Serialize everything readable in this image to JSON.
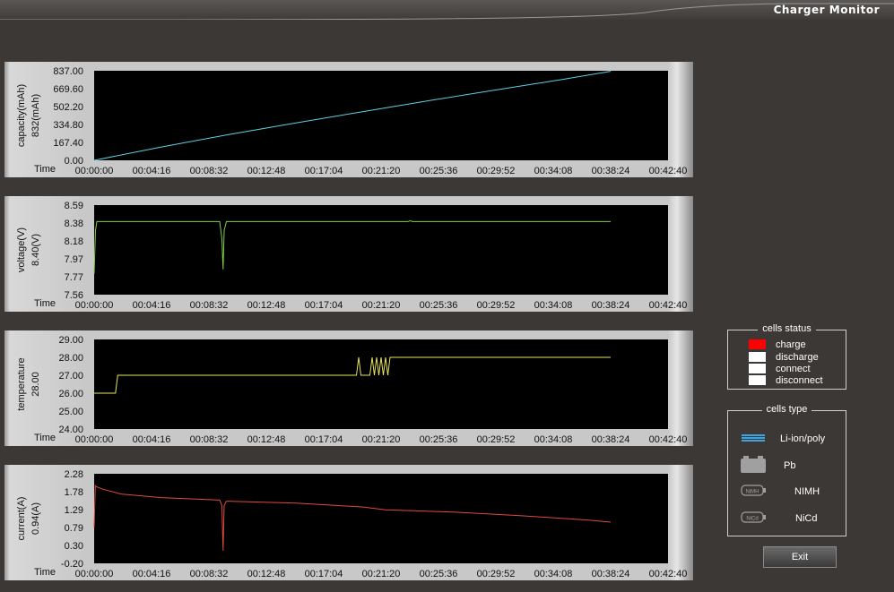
{
  "app_title": "Charger Monitor",
  "time_ticks": [
    "00:00:00",
    "00:04:16",
    "00:08:32",
    "00:12:48",
    "00:17:04",
    "00:21:20",
    "00:25:36",
    "00:29:52",
    "00:34:08",
    "00:38:24",
    "00:42:40"
  ],
  "time_label": "Time",
  "colors": {
    "capacity": "#5fd0e0",
    "voltage": "#7ecf4a",
    "temperature": "#e8e65a",
    "current": "#e04a3c",
    "charge": "#ff0000"
  },
  "panels": [
    {
      "id": "capacity",
      "ylabel": "capacity(mAh)",
      "current_value": "832(mAh)",
      "ticks": [
        "837.00",
        "669.60",
        "502.20",
        "334.80",
        "167.40",
        "0.00"
      ],
      "chart_data": {
        "type": "line",
        "x_unit": "seconds",
        "ylim": [
          0,
          837
        ],
        "x": [
          0,
          300,
          600,
          900,
          1200,
          1500,
          1800,
          2100,
          2304
        ],
        "y": [
          0,
          125,
          240,
          350,
          455,
          560,
          660,
          760,
          832
        ]
      }
    },
    {
      "id": "voltage",
      "ylabel": "voltage(V)",
      "current_value": "8.40(V)",
      "ticks": [
        "8.59",
        "8.38",
        "8.18",
        "7.97",
        "7.77",
        "7.56"
      ],
      "chart_data": {
        "type": "line",
        "x_unit": "seconds",
        "ylim": [
          7.56,
          8.59
        ],
        "x": [
          0,
          6,
          12,
          20,
          560,
          570,
          575,
          580,
          590,
          600,
          1400,
          1410,
          1420,
          2304
        ],
        "y": [
          7.8,
          8.3,
          8.4,
          8.4,
          8.4,
          8.2,
          7.85,
          8.3,
          8.4,
          8.4,
          8.4,
          8.41,
          8.4,
          8.4
        ]
      }
    },
    {
      "id": "temperature",
      "ylabel": "temperature",
      "current_value": "28.00",
      "ticks": [
        "29.00",
        "28.00",
        "27.00",
        "26.00",
        "25.00",
        "24.00"
      ],
      "chart_data": {
        "type": "line",
        "x_unit": "seconds",
        "ylim": [
          24,
          29
        ],
        "x": [
          0,
          95,
          100,
          105,
          1170,
          1180,
          1190,
          1200,
          1230,
          1240,
          1250,
          1260,
          1270,
          1280,
          1290,
          1300,
          1310,
          1320,
          2304
        ],
        "y": [
          26,
          26,
          26.5,
          27,
          27,
          28,
          27,
          27,
          27,
          28,
          27,
          28,
          27,
          28,
          27,
          28,
          27,
          28,
          28
        ]
      }
    },
    {
      "id": "current",
      "ylabel": "current(A)",
      "current_value": "0.94(A)",
      "ticks": [
        "2.28",
        "1.78",
        "1.29",
        "0.79",
        "0.30",
        "-0.20"
      ],
      "chart_data": {
        "type": "line",
        "x_unit": "seconds",
        "ylim": [
          -0.2,
          2.28
        ],
        "x": [
          0,
          5,
          10,
          40,
          120,
          300,
          560,
          570,
          575,
          580,
          590,
          900,
          1200,
          1300,
          1600,
          1900,
          2200,
          2304
        ],
        "y": [
          0.8,
          1.95,
          1.92,
          1.85,
          1.72,
          1.62,
          1.55,
          1.4,
          0.15,
          1.4,
          1.52,
          1.47,
          1.36,
          1.28,
          1.22,
          1.12,
          1.0,
          0.94
        ]
      }
    }
  ],
  "cells_status": {
    "title": "cells status",
    "items": [
      {
        "label": "charge",
        "color": "#ff0000"
      },
      {
        "label": "discharge",
        "color": "#ffffff"
      },
      {
        "label": "connect",
        "color": "#ffffff"
      },
      {
        "label": "disconnect",
        "color": "#ffffff"
      }
    ]
  },
  "cells_type": {
    "title": "cells type",
    "items": [
      {
        "label": "Li-ion/poly",
        "icon": "li-ion-battery-icon"
      },
      {
        "label": "Pb",
        "icon": "pb-battery-icon"
      },
      {
        "label": "NIMH",
        "icon": "nimh-battery-icon",
        "icon_text": "NiMH"
      },
      {
        "label": "NiCd",
        "icon": "nicd-battery-icon",
        "icon_text": "NiCd"
      }
    ]
  },
  "exit_label": "Exit"
}
